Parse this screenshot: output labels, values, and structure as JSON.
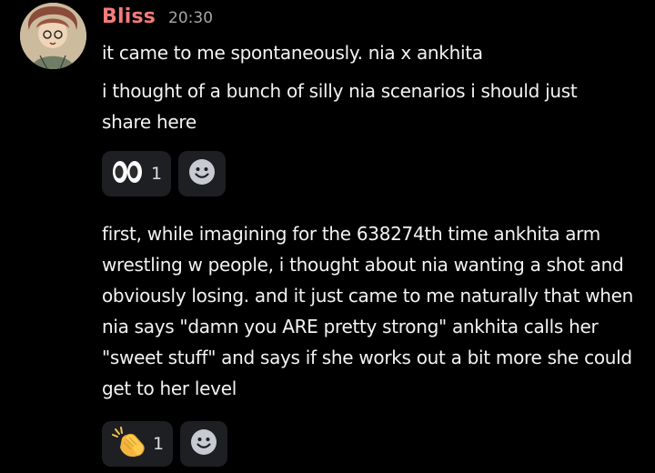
{
  "message": {
    "author": "Bliss",
    "time": "20:30",
    "lines": [
      "it came to me spontaneously. nia x ankhita",
      "i thought of a bunch of silly nia scenarios i should just share here"
    ],
    "reaction1": {
      "emoji_icon": "eyes-icon",
      "count": "1"
    },
    "body2": "first, while imagining for the 638274th time ankhita arm wrestling w people, i thought about nia wanting a shot and obviously losing. and it just came to me naturally that when nia says \"damn you ARE pretty strong\" ankhita calls her \"sweet stuff\" and says if she works out a bit more she could get to her level",
    "reaction2": {
      "emoji_icon": "clapping-hands-icon",
      "count": "1"
    }
  },
  "colors": {
    "background": "#000000",
    "username": "#f47b7b",
    "timestamp": "#a3a6aa",
    "reaction_bg": "#1e1f22"
  }
}
